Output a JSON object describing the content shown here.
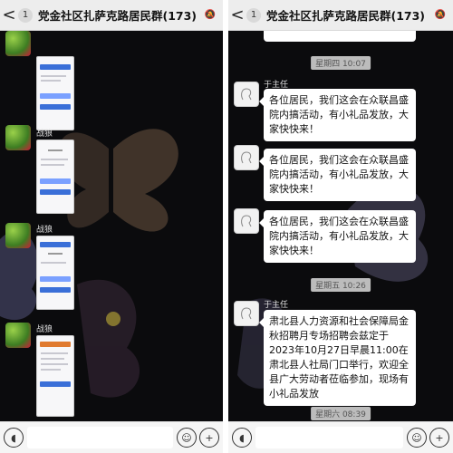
{
  "left": {
    "header": {
      "back": "<",
      "badge": "1",
      "title": "党金社区扎萨克路居民群(173)"
    },
    "messages": [
      {
        "sender": "战狼",
        "type": "image"
      },
      {
        "sender": "战狼",
        "type": "image"
      },
      {
        "sender": "战狼",
        "type": "image"
      }
    ]
  },
  "right": {
    "header": {
      "back": "<",
      "badge": "1",
      "title": "党金社区扎萨克路居民群(173)"
    },
    "timestamps": [
      "星期四 10:07",
      "星期五 10:26",
      "星期六 08:39"
    ],
    "messages": [
      {
        "sender": "于主任",
        "text": "各位居民，我们这会在众联昌盛院内搞活动，有小礼品发放，大家快快来！"
      },
      {
        "sender": "",
        "text": "各位居民，我们这会在众联昌盛院内搞活动，有小礼品发放，大家快快来！"
      },
      {
        "sender": "",
        "text": "各位居民，我们这会在众联昌盛院内搞活动，有小礼品发放，大家快快来！"
      },
      {
        "sender": "于主任",
        "text": "肃北县人力资源和社会保障局金秋招聘月专场招聘会兹定于2023年10月27日早晨11:00在肃北县人社局门口举行，欢迎全县广大劳动者莅临参加，现场有小礼品发放"
      }
    ]
  },
  "icons": {
    "voice": "voice-icon",
    "emoji": "emoji-icon",
    "plus": "plus-icon"
  },
  "colors": {
    "header_bg": "#ededed",
    "chat_bg": "#0b0b0d",
    "bubble": "#ffffff",
    "timestamp_bg": "#dcdcdc"
  }
}
